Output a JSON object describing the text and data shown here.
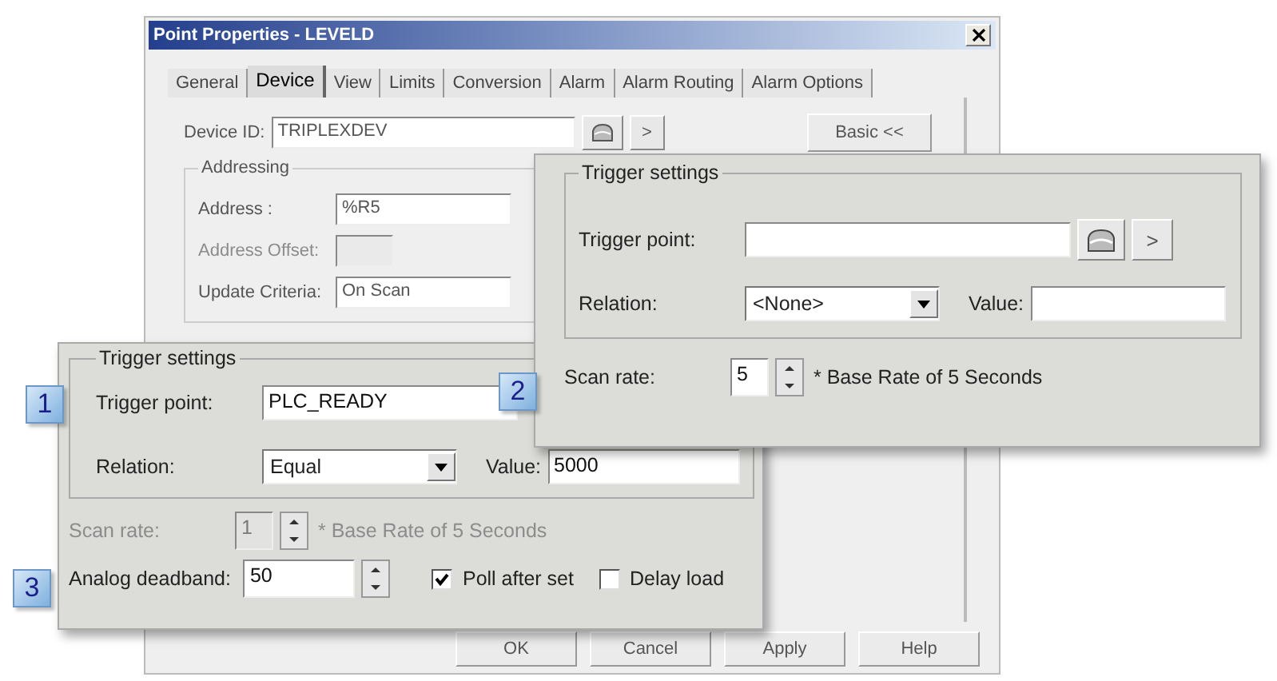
{
  "dialog": {
    "title": "Point Properties - LEVELD",
    "tabs": [
      {
        "label": "General",
        "selected": false
      },
      {
        "label": "Device",
        "selected": true
      },
      {
        "label": "View",
        "selected": false
      },
      {
        "label": "Limits",
        "selected": false
      },
      {
        "label": "Conversion",
        "selected": false
      },
      {
        "label": "Alarm",
        "selected": false
      },
      {
        "label": "Alarm Routing",
        "selected": false
      },
      {
        "label": "Alarm Options",
        "selected": false
      }
    ],
    "device_id": {
      "label": "Device ID:",
      "value": "TRIPLEXDEV"
    },
    "more_button": ">",
    "basic_button": "Basic <<",
    "addressing": {
      "title": "Addressing",
      "fields": [
        {
          "label": "Address :",
          "value": "%R5",
          "disabled": false
        },
        {
          "label": "Address Offset:",
          "disabled": true
        },
        {
          "label": "Update Criteria:",
          "value": "On Scan",
          "disabled": false
        }
      ]
    },
    "buttons": [
      "OK",
      "Cancel",
      "Apply",
      "Help"
    ]
  },
  "callout_trigger": {
    "badges": [
      "1",
      "3"
    ],
    "trigger_settings": {
      "title": "Trigger settings",
      "trigger_point": {
        "label": "Trigger point:",
        "value": "PLC_READY"
      },
      "relation": {
        "label": "Relation:",
        "value": "Equal"
      },
      "value": {
        "label": "Value:",
        "value": "5000"
      }
    },
    "scan_rate": {
      "label": "Scan rate:",
      "value": "1",
      "note": "* Base Rate of 5 Seconds",
      "disabled": true
    },
    "analog_deadband": {
      "label": "Analog deadband:",
      "value": "50"
    },
    "checkboxes": [
      {
        "label": "Poll after set",
        "checked": true
      },
      {
        "label": "Delay load",
        "checked": false
      }
    ]
  },
  "callout_scan": {
    "badge": "2",
    "trigger_settings": {
      "title": "Trigger settings",
      "trigger_point": {
        "label": "Trigger point:"
      },
      "more_button": ">",
      "relation": {
        "label": "Relation:",
        "value": "<None>"
      },
      "value": {
        "label": "Value:"
      }
    },
    "scan_rate": {
      "label": "Scan rate:",
      "value": "5",
      "note": "* Base Rate of 5 Seconds",
      "disabled": false
    }
  }
}
